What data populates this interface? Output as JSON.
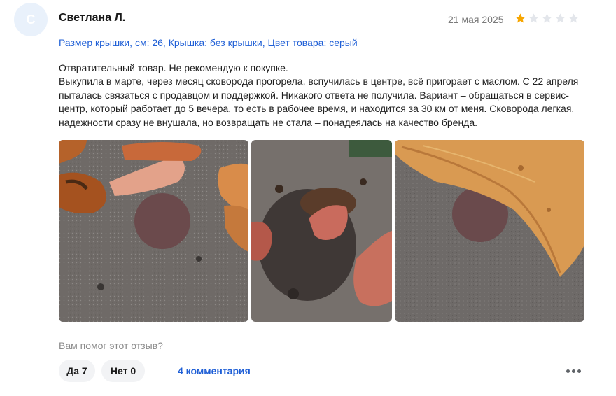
{
  "review": {
    "avatar_letter": "С",
    "author": "Светлана Л.",
    "date": "21 мая 2025",
    "rating": 1,
    "max_rating": 5,
    "star_color_active": "#f7a600",
    "star_color_inactive": "#e3e6eb",
    "variant": "Размер крышки, см: 26, Крышка: без крышки, Цвет товара: серый",
    "text_lines": [
      "Отвратительный товар. Не рекомендую к покупке.",
      "Выкупила в марте, через месяц сковорода прогорела, вспучилась в центре, всё пригорает с маслом. С 22 апреля пыталась связаться с продавцом и поддержкой. Никакого ответа не получила. Вариант – обращаться в сервис-центр, который работает до 5 вечера, то есть в рабочее время, и находится за 30 км от меня. Сковорода легкая, надежности сразу не внушала, но возвращать не стала – понадеялась на качество бренда."
    ],
    "photos": [
      {
        "name": "photo-pan-chicken"
      },
      {
        "name": "photo-pan-burnt-meat"
      },
      {
        "name": "photo-pan-lavash"
      }
    ]
  },
  "feedback": {
    "question": "Вам помог этот отзыв?",
    "yes_label": "Да 7",
    "no_label": "Нет 0",
    "comments_label": "4 комментария"
  },
  "icons": {
    "star": "star-icon",
    "more": "more-dots-icon"
  }
}
